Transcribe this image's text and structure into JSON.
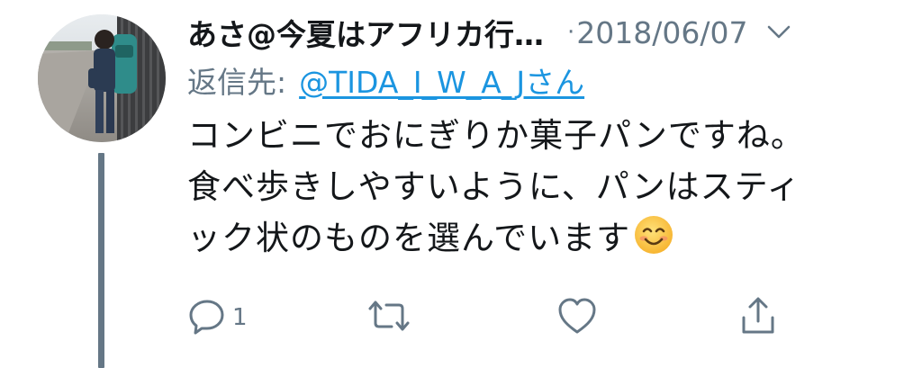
{
  "tweet": {
    "display_name": "あさ@今夏はアフリカ行…",
    "separator": "·",
    "timestamp": "2018/06/07",
    "reply_prefix": "返信先:",
    "reply_handle": "@TIDA_I_W_A_Jさん",
    "text_lines": [
      "コンビニでおにぎりか菓子パンですね。",
      "食べ歩きしやすいように、パンはスティ",
      "ック状のものを選んでいます"
    ],
    "emoji": "smiling-face-emoji"
  },
  "actions": {
    "reply": {
      "icon": "reply-icon",
      "count": "1"
    },
    "retweet": {
      "icon": "retweet-icon",
      "count": ""
    },
    "like": {
      "icon": "heart-icon",
      "count": ""
    },
    "share": {
      "icon": "share-icon",
      "count": ""
    }
  },
  "colors": {
    "text": "#14171a",
    "secondary": "#657786",
    "link": "#1b95e0",
    "thread_line": "#657786"
  }
}
